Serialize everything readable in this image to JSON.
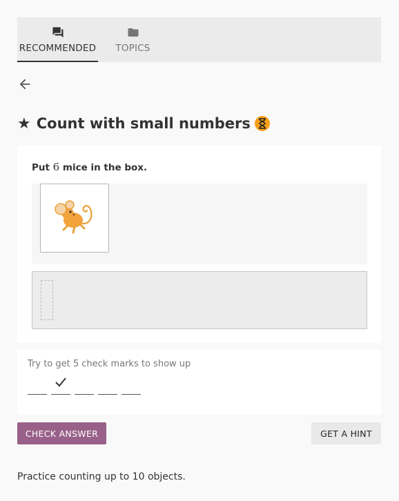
{
  "tabs": [
    {
      "label": "RECOMMENDED",
      "icon": "forum-icon",
      "active": true
    },
    {
      "label": "TOPICS",
      "icon": "folder-icon",
      "active": false
    }
  ],
  "header": {
    "back_icon": "arrow-back-icon",
    "title": "Count with small numbers",
    "star_icon": "star-icon",
    "status_icon": "hourglass-icon",
    "status_color": "#f6a01a"
  },
  "question": {
    "prompt_prefix": "Put",
    "prompt_number": "6",
    "prompt_suffix": "mice in the box.",
    "draggable_item": "mouse-icon"
  },
  "progress": {
    "message": "Try to get 5 check marks to show up",
    "total": 5,
    "marks": [
      false,
      true,
      false,
      false,
      false
    ]
  },
  "buttons": {
    "check_answer": "CHECK ANSWER",
    "get_hint": "GET A HINT"
  },
  "description": "Practice counting up to 10 objects.",
  "colors": {
    "primary": "#996189",
    "tab_bar": "#ebebeb",
    "status": "#f6a01a"
  }
}
